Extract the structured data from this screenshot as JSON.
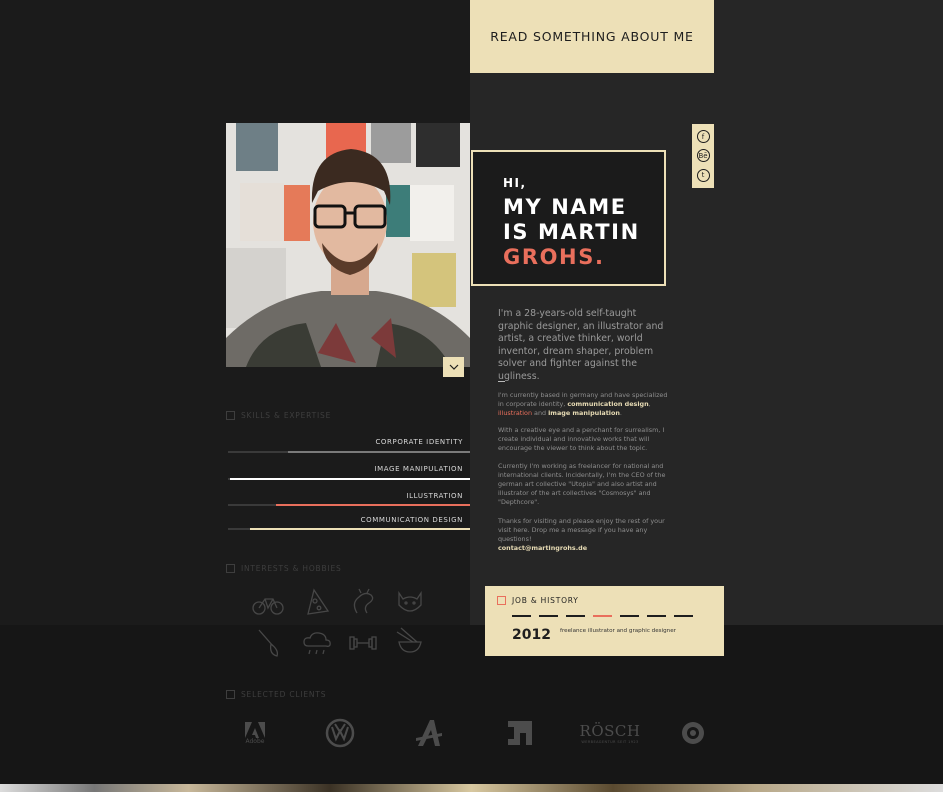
{
  "header": {
    "read_tab_label": "READ SOMETHING ABOUT ME"
  },
  "social": {
    "items": [
      "facebook-icon",
      "behance-icon",
      "twitter-icon"
    ],
    "labels": [
      "f",
      "Bē",
      "t"
    ]
  },
  "hello": {
    "hi": "HI,",
    "line1": "MY NAME",
    "line2": "IS MARTIN",
    "line3": "GROHS."
  },
  "intro": {
    "text": "I'm a 28-years-old self-taught graphic designer, an illustrator and artist, a creative thinker, world inventor, dream shaper, problem solver and fighter against the ugliness."
  },
  "about": {
    "p1_a": "I'm currently based in germany and have specialized in corporate identity, ",
    "p1_b": "communication design",
    "p1_c": ", ",
    "p1_d": "illustration",
    "p1_e": " and ",
    "p1_f": "image manipulation",
    "p1_g": ".",
    "p2": "With a creative eye and a penchant for surrealism, I create individual and innovative works that will encourage the viewer to think about the topic.",
    "p3": "Currently I'm working as freelancer for national and international clients. Incidentally, I'm the CEO of the german art collective \"Utopia\" and also artist and illustrator of the art collectives \"Cosmosys\" and \"Depthcore\".",
    "p4": "Thanks for visiting and please enjoy the rest of your visit here. Drop me a message if you have any questions!",
    "email": "contact@martingrohs.de"
  },
  "skills": {
    "heading": "SKILLS & EXPERTISE",
    "items": [
      {
        "label": "CORPORATE IDENTITY",
        "level": 0.75,
        "color": "#7a7a7a"
      },
      {
        "label": "IMAGE MANIPULATION",
        "level": 0.99,
        "color": "#ffffff"
      },
      {
        "label": "ILLUSTRATION",
        "level": 0.8,
        "color": "#e96f5c"
      },
      {
        "label": "COMMUNICATION DESIGN",
        "level": 0.91,
        "color": "#ede0b7"
      }
    ]
  },
  "interests": {
    "heading": "INTERESTS & HOBBIES",
    "icons": [
      "bicycle-icon",
      "pizza-icon",
      "dragon-icon",
      "cat-icon",
      "brush-icon",
      "cloud-icon",
      "dumbbell-icon",
      "food-bowl-icon"
    ]
  },
  "clients": {
    "heading": "SELECTED CLIENTS",
    "adobe": "Adobe",
    "vw": "VW",
    "rosch": "RÖSCH",
    "rosch_sub": "WERBEAGENTUR SEIT 1923"
  },
  "job": {
    "heading": "JOB & HISTORY",
    "year": "2012",
    "description": "freelance illustrator and graphic designer",
    "timeline_count": 7,
    "active_index": 3
  },
  "colors": {
    "accent": "#e96f5c",
    "cream": "#ede0b7",
    "dark": "#1b1b1b",
    "panel": "#262626"
  }
}
